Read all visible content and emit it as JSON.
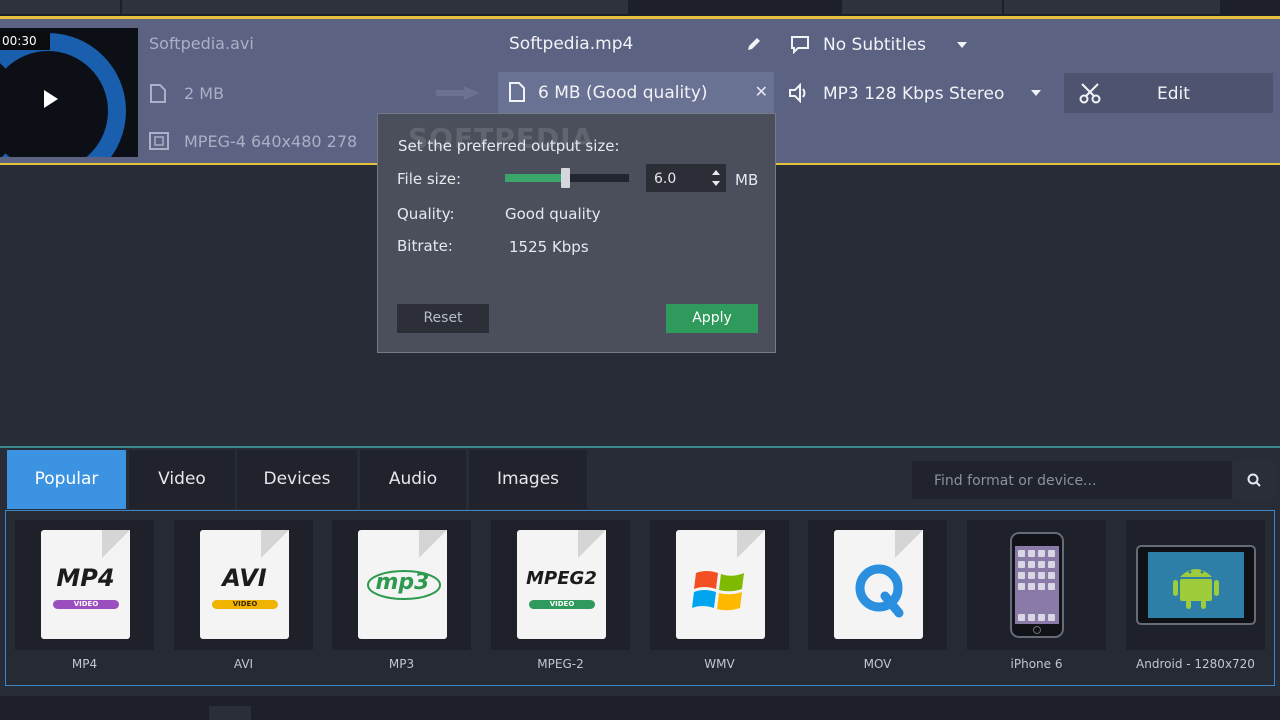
{
  "video": {
    "time": "00:30",
    "source_name": "Softpedia.avi",
    "source_size": "2 MB",
    "source_format": "MPEG-4 640x480 278"
  },
  "output": {
    "name": "Softpedia.mp4",
    "size_label": "6 MB (Good quality)",
    "subtitles": "No Subtitles",
    "audio": "MP3 128 Kbps Stereo",
    "edit_label": "Edit"
  },
  "popup": {
    "watermark": "SOFTPEDIA",
    "title": "Set the preferred output size:",
    "file_size_label": "File size:",
    "file_size_value": "6.0",
    "file_size_unit": "MB",
    "slider_fraction": 0.48,
    "quality_label": "Quality:",
    "quality_value": "Good quality",
    "bitrate_label": "Bitrate:",
    "bitrate_value": "1525 Kbps",
    "reset_label": "Reset",
    "apply_label": "Apply"
  },
  "tabs": [
    "Popular",
    "Video",
    "Devices",
    "Audio",
    "Images"
  ],
  "active_tab": "Popular",
  "search": {
    "placeholder": "Find format or device..."
  },
  "formats": [
    {
      "caption": "MP4",
      "icon": "mp4-icon",
      "logo": "MP4",
      "band": "VIDEO",
      "band_color": "#9b4fbf"
    },
    {
      "caption": "AVI",
      "icon": "avi-icon",
      "logo": "AVI",
      "band": "VIDEO",
      "band_color": "#f0b400"
    },
    {
      "caption": "MP3",
      "icon": "mp3-icon",
      "logo": "mp3"
    },
    {
      "caption": "MPEG-2",
      "icon": "mpeg2-icon",
      "logo": "MPEG2",
      "band": "VIDEO",
      "band_color": "#2f9a5b"
    },
    {
      "caption": "WMV",
      "icon": "windows-logo-icon"
    },
    {
      "caption": "MOV",
      "icon": "quicktime-icon"
    },
    {
      "caption": "iPhone 6",
      "icon": "iphone-icon"
    },
    {
      "caption": "Android - 1280x720",
      "icon": "android-tablet-icon"
    }
  ],
  "colors": {
    "accent": "#e6c23a",
    "tab_active": "#3c93e2",
    "apply": "#2f9a5b",
    "slider_fill": "#3aa66a"
  }
}
